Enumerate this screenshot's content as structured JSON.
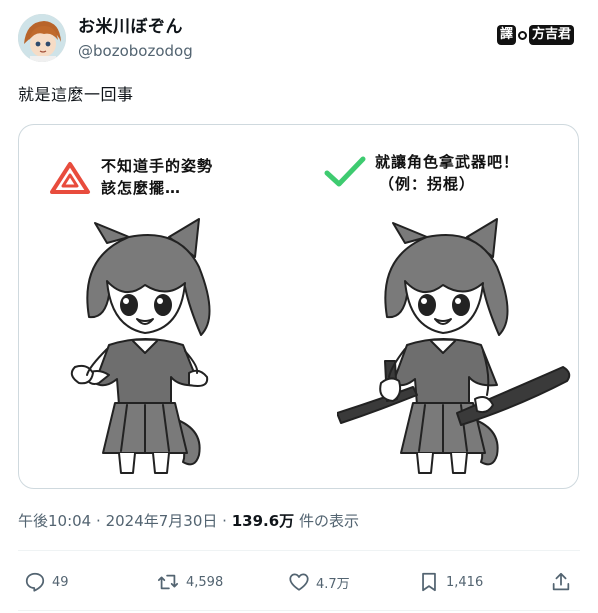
{
  "author": {
    "display_name": "お米川ぼぞん",
    "handle": "@bozobozodog"
  },
  "watermark": {
    "part1": "譯",
    "part2": "方吉君"
  },
  "tweet": {
    "text": "就是這麼一回事"
  },
  "image_panel": {
    "left_caption_line1": "不知道手的姿勢",
    "left_caption_line2": "該怎麼擺…",
    "left_icon": "warning-triangle-icon",
    "right_caption_line1": "就讓角色拿武器吧！",
    "right_caption_line2": "（例：拐棍）",
    "right_icon": "check-mark-icon",
    "accent_warn": "#e84c3d",
    "accent_ok": "#3ecb70"
  },
  "meta": {
    "time": "午後10:04",
    "sep1": "·",
    "date": "2024年7月30日",
    "sep2": "·",
    "views_count": "139.6万",
    "views_label": "件の表示"
  },
  "actions": {
    "replies": "49",
    "reposts": "4,598",
    "likes": "4.7万",
    "bookmarks": "1,416"
  },
  "colors": {
    "text": "#0f1419",
    "secondary": "#536471",
    "border": "#cfd9de"
  }
}
